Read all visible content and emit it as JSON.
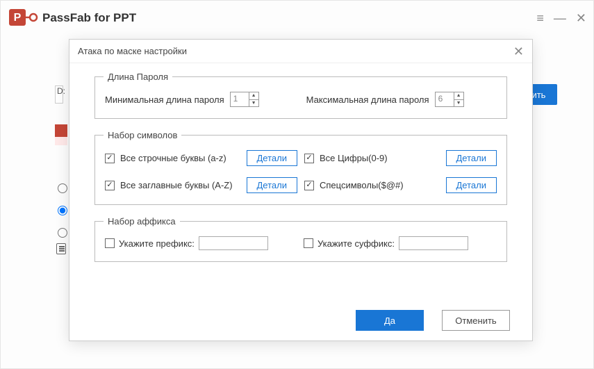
{
  "app": {
    "title": "PassFab for PPT"
  },
  "window_controls": {
    "menu": "≡",
    "minimize": "—",
    "close": "✕"
  },
  "background": {
    "path_prefix": "D:",
    "right_button_fragment": "вить"
  },
  "modal": {
    "title": "Атака по маске настройки",
    "length": {
      "legend": "Длина Пароля",
      "min_label": "Минимальная длина пароля",
      "min_value": "1",
      "max_label": "Максимальная длина пароля",
      "max_value": "6"
    },
    "charset": {
      "legend": "Набор символов",
      "detail_button": "Детали",
      "items": {
        "lowercase": "Все строчные буквы (a-z)",
        "digits": "Все Цифры(0-9)",
        "uppercase": "Все заглавные буквы (A-Z)",
        "symbols": "Спецсимволы($@#)"
      }
    },
    "affix": {
      "legend": "Набор аффикса",
      "prefix_label": "Укажите префикс:",
      "suffix_label": "Укажите суффикс:"
    },
    "buttons": {
      "ok": "Да",
      "cancel": "Отменить"
    }
  }
}
